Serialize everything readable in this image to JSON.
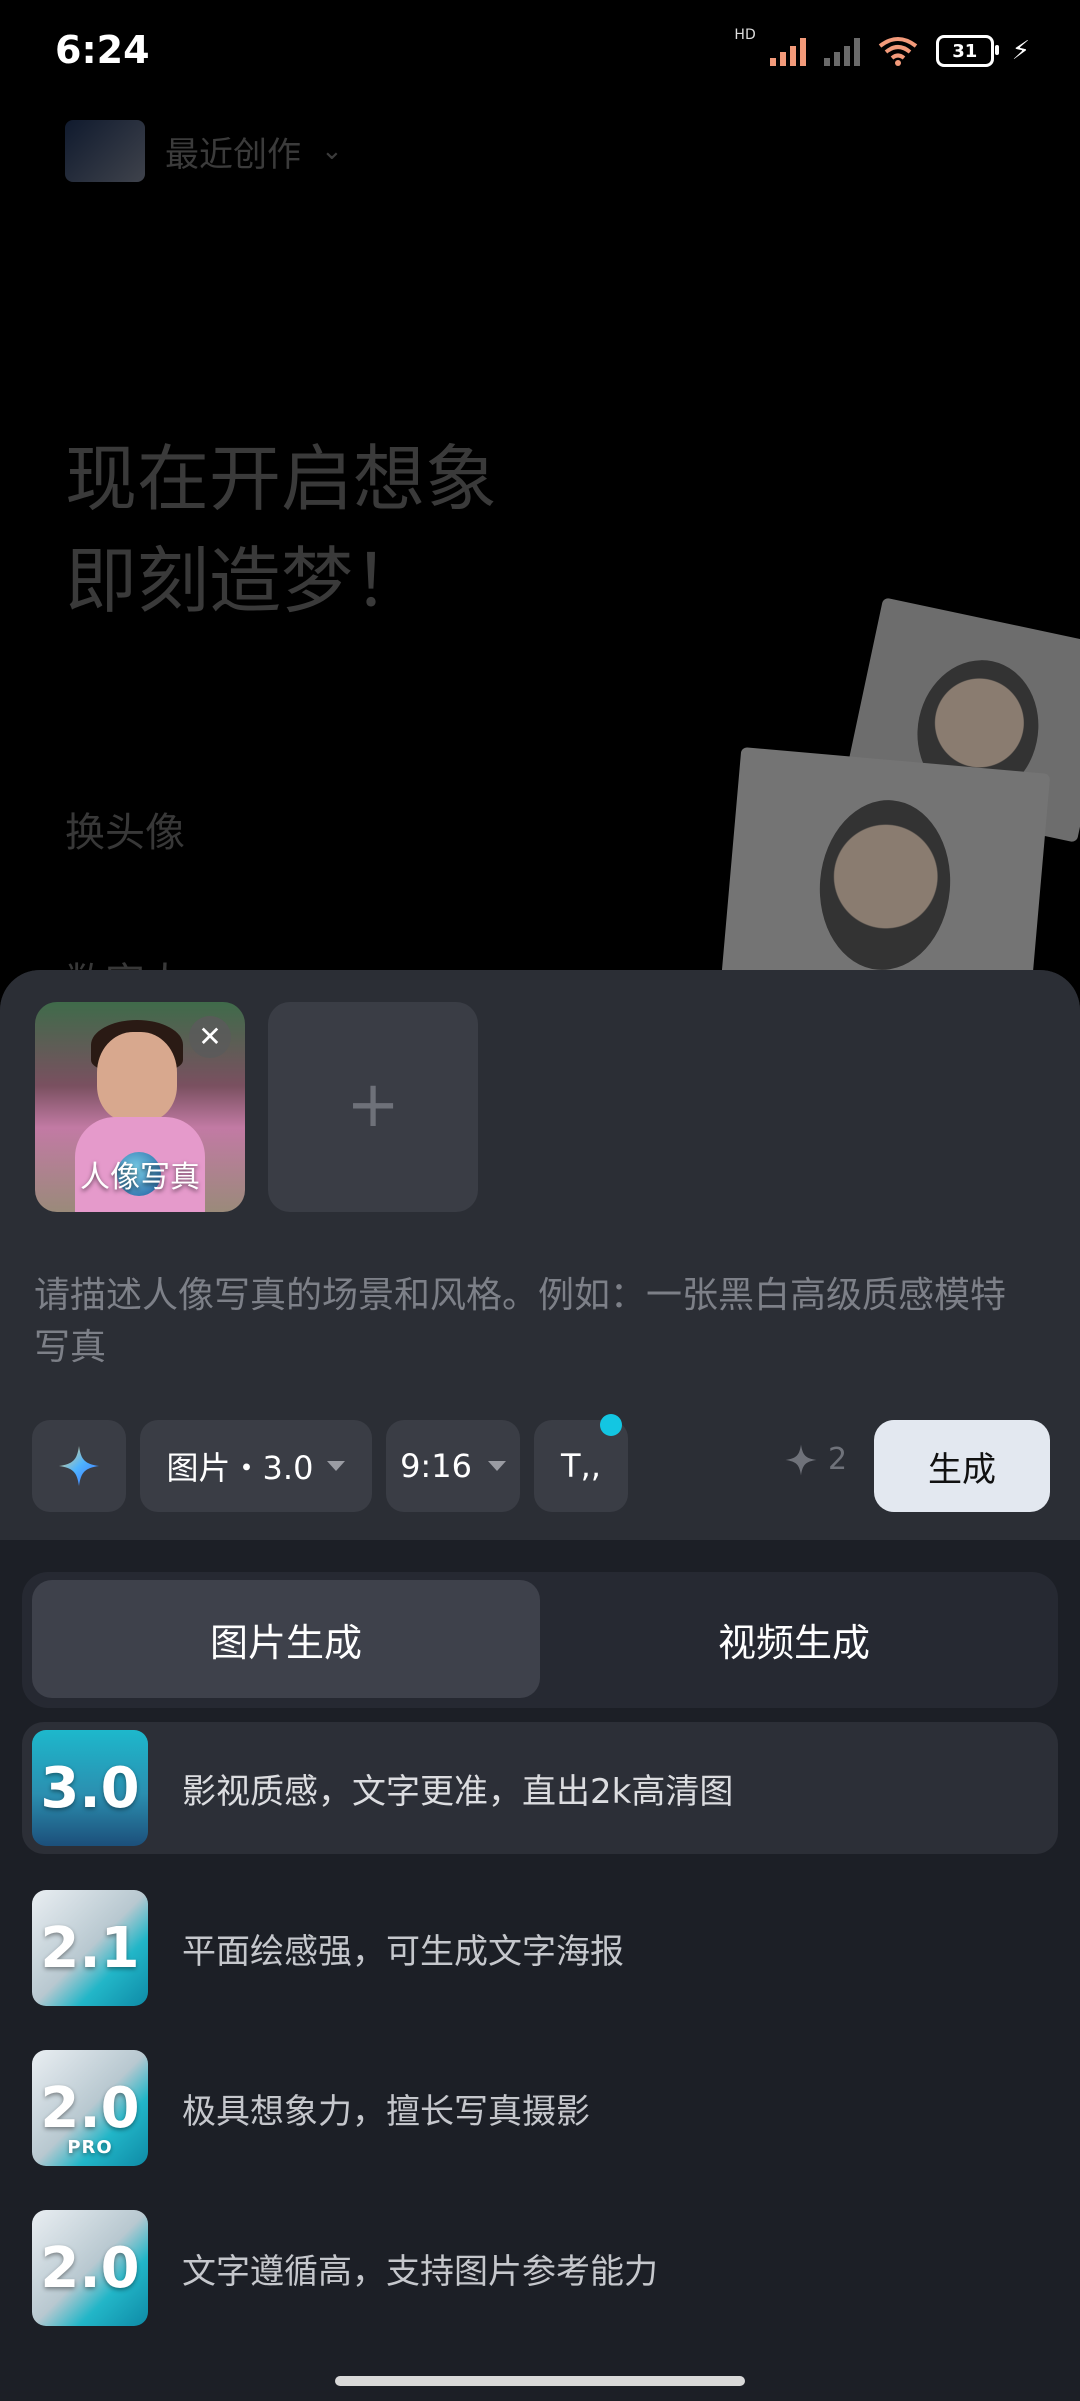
{
  "status_bar": {
    "time": "6:24",
    "hd": "HD",
    "battery": "31"
  },
  "background": {
    "recent_label": "最近创作",
    "headline_line1": "现在开启想象",
    "headline_line2": "即刻造梦！",
    "item1": "换头像",
    "item2": "数字人"
  },
  "sheet": {
    "reference_image": {
      "label": "人像写真"
    },
    "prompt_placeholder": "请描述人像写真的场景和风格。例如：一张黑白高级质感模特写真",
    "toolbar": {
      "model": "图片・3.0",
      "ratio": "9:16",
      "text_button": "T,,",
      "credits": "2",
      "generate": "生成"
    },
    "tabs": {
      "image": "图片生成",
      "video": "视频生成"
    },
    "models": [
      {
        "version": "3.0",
        "desc": "影视质感，文字更准，直出2k高清图",
        "selected": true
      },
      {
        "version": "2.1",
        "desc": "平面绘感强，可生成文字海报",
        "selected": false
      },
      {
        "version": "2.0",
        "badge": "PRO",
        "desc": "极具想象力，擅长写真摄影",
        "selected": false
      },
      {
        "version": "2.0",
        "desc": "文字遵循高，支持图片参考能力",
        "selected": false
      }
    ]
  },
  "colors": {
    "accent_cyan": "#13c6e2",
    "generate_bg": "#e3e8f0",
    "sheet_bg": "#2b2e35"
  }
}
